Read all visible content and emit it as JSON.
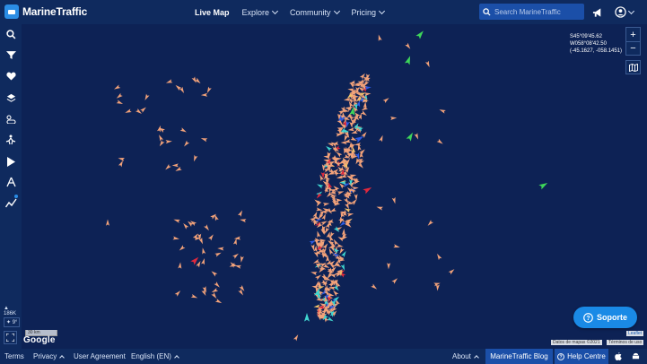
{
  "brand": {
    "name": "MarineTraffic"
  },
  "nav": {
    "live_map": "Live Map",
    "explore": "Explore",
    "community": "Community",
    "pricing": "Pricing"
  },
  "search": {
    "placeholder": "Search MarineTraffic"
  },
  "sidebar": {
    "vessel_count": "186K",
    "weather_temp": "9°"
  },
  "map": {
    "coords": {
      "lat": "S45°09'45.62",
      "lon": "W058°08'42.50",
      "decimal": "(-45.1627, -058.1451)"
    },
    "zoom_in": "+",
    "zoom_out": "−",
    "scale_label": "30 km",
    "google_label": "Google",
    "leaflet": "Leaflet",
    "attribution": "Datos de mapas ©2021",
    "terms_map": "Términos de uso"
  },
  "soporte": {
    "label": "Soporte"
  },
  "footer": {
    "terms": "Terms",
    "privacy": "Privacy",
    "user_agreement": "User Agreement",
    "language": "English (EN)",
    "about": "About",
    "blog": "MarineTraffic Blog",
    "help": "Help Centre"
  },
  "colors": {
    "map_bg": "#0d2255",
    "bar_bg": "#0f2a5e",
    "accent": "#1a8ae6",
    "vessel_fishing": "#f2a27a",
    "vessel_cargo": "#3fd6d0",
    "vessel_tanker": "#e0283c",
    "vessel_passenger": "#2d5be3",
    "vessel_pleasure": "#3ed65a",
    "vessel_other": "#f0c36a"
  },
  "icons": {
    "search": "search-icon",
    "filter": "filter-icon",
    "favorites": "heart-icon",
    "layers": "layers-icon",
    "weather": "weather-icon",
    "routes": "route-icon",
    "playback": "play-icon",
    "measure": "measure-icon",
    "analytics": "analytics-icon"
  }
}
